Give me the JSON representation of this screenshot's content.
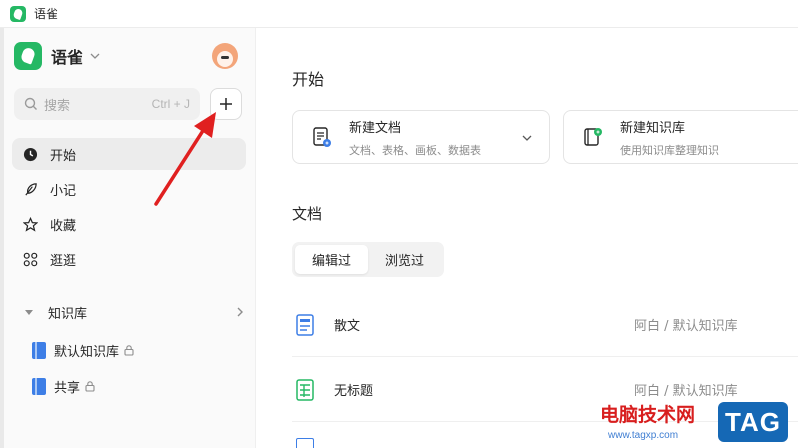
{
  "window": {
    "title": "语雀"
  },
  "sidebar": {
    "brand_name": "语雀",
    "search": {
      "placeholder": "搜索",
      "shortcut": "Ctrl + J"
    },
    "nav": [
      {
        "label": "开始",
        "icon": "clock-icon",
        "active": true
      },
      {
        "label": "小记",
        "icon": "feather-icon",
        "active": false
      },
      {
        "label": "收藏",
        "icon": "star-icon",
        "active": false
      },
      {
        "label": "逛逛",
        "icon": "grid-icon",
        "active": false
      }
    ],
    "knowledge_base": {
      "header": "知识库",
      "items": [
        {
          "label": "默认知识库",
          "icon": "book-icon",
          "locked": true
        },
        {
          "label": "共享",
          "icon": "book-icon",
          "locked": true
        }
      ]
    }
  },
  "main": {
    "title": "开始",
    "cards": [
      {
        "title": "新建文档",
        "subtitle": "文档、表格、画板、数据表",
        "icon": "new-doc-icon"
      },
      {
        "title": "新建知识库",
        "subtitle": "使用知识库整理知识",
        "icon": "new-kb-icon"
      }
    ],
    "docs_section": {
      "title": "文档",
      "tabs": [
        {
          "label": "编辑过",
          "active": true
        },
        {
          "label": "浏览过",
          "active": false
        }
      ],
      "rows": [
        {
          "title": "散文",
          "path": "阿白 / 默认知识库",
          "icon": "doc-icon"
        },
        {
          "title": "无标题",
          "path": "阿白 / 默认知识库",
          "icon": "sheet-icon"
        }
      ]
    }
  },
  "watermark": {
    "text": "电脑技术网",
    "url": "www.tagxp.com",
    "badge": "TAG"
  },
  "colors": {
    "brand": "#25b864",
    "accent_blue": "#3d7ee6",
    "arrow": "#e02020"
  }
}
